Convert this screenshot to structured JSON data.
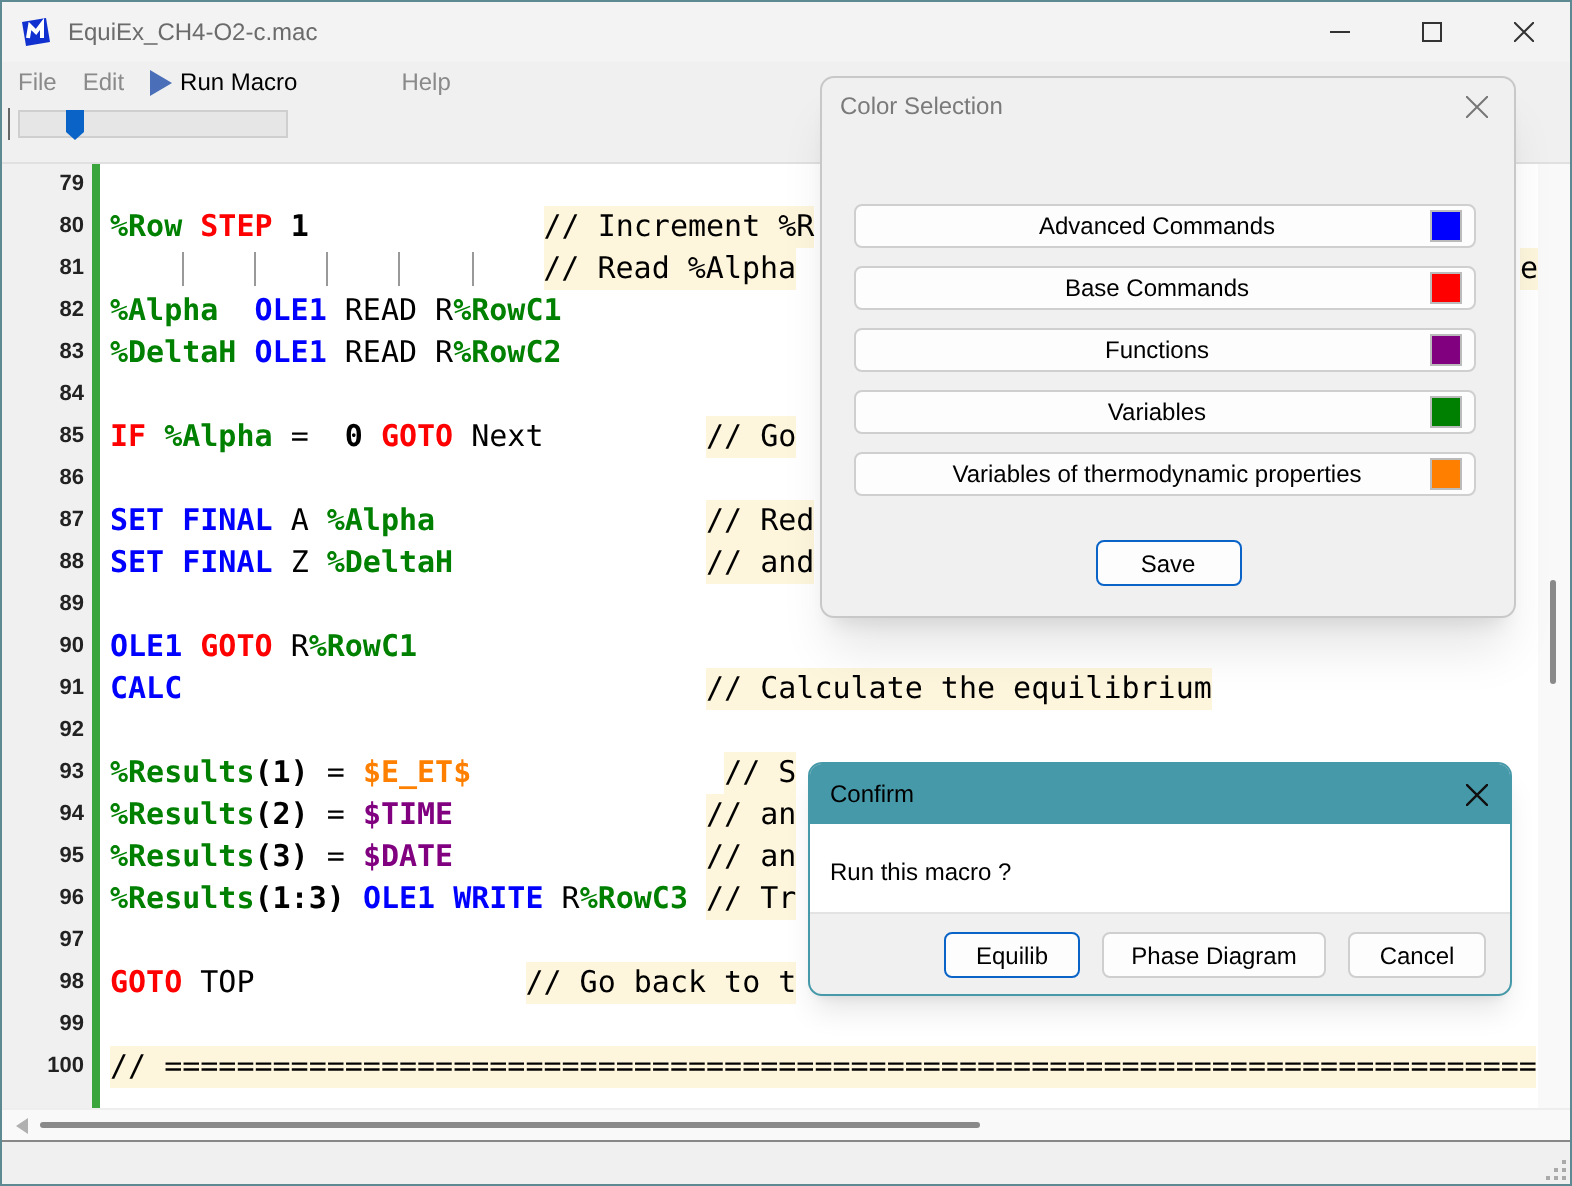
{
  "window": {
    "title": "EquiEx_CH4-O2-c.mac"
  },
  "menu": [
    {
      "label": "File",
      "kind": "text",
      "disabled": true
    },
    {
      "label": "Edit",
      "kind": "text",
      "disabled": true
    },
    {
      "label": "Run Macro",
      "kind": "run",
      "disabled": false
    },
    {
      "label": "Help",
      "kind": "text",
      "disabled": true
    }
  ],
  "speed_slider": {
    "level": 0.2
  },
  "editor": {
    "lines": [
      {
        "number": "79"
      },
      {
        "number": "80",
        "tokens": [
          {
            "kind": "var",
            "text": "%Row"
          },
          {
            "kind": "base",
            "text": " STEP"
          },
          {
            "kind": "num",
            "text": " 1"
          },
          {
            "kind": "comment",
            "text": "             // Increment %R"
          }
        ]
      },
      {
        "number": "81",
        "tokens": [
          {
            "kind": "tab"
          },
          {
            "kind": "tab"
          },
          {
            "kind": "tab"
          },
          {
            "kind": "tab"
          },
          {
            "kind": "tab"
          },
          {
            "kind": "tab"
          },
          {
            "kind": "comment",
            "text": "// Read %Alpha"
          },
          {
            "kind": "comment_tail",
            "text": "e"
          }
        ]
      },
      {
        "number": "82",
        "tokens": [
          {
            "kind": "var",
            "text": "%Alpha"
          },
          {
            "kind": "adv",
            "text": "  OLE1"
          },
          {
            "kind": "plain",
            "text": " READ R"
          },
          {
            "kind": "var",
            "text": "%RowC1"
          }
        ]
      },
      {
        "number": "83",
        "tokens": [
          {
            "kind": "var",
            "text": "%DeltaH"
          },
          {
            "kind": "adv",
            "text": " OLE1"
          },
          {
            "kind": "plain",
            "text": " READ R"
          },
          {
            "kind": "var",
            "text": "%RowC2"
          }
        ]
      },
      {
        "number": "84"
      },
      {
        "number": "85",
        "tokens": [
          {
            "kind": "base",
            "text": "IF"
          },
          {
            "kind": "var",
            "text": " %Alpha"
          },
          {
            "kind": "plain",
            "text": " =  "
          },
          {
            "kind": "num",
            "text": "0"
          },
          {
            "kind": "base",
            "text": " GOTO"
          },
          {
            "kind": "plain",
            "text": " Next"
          },
          {
            "kind": "comment",
            "text": "         // Go"
          }
        ]
      },
      {
        "number": "86"
      },
      {
        "number": "87",
        "tokens": [
          {
            "kind": "adv",
            "text": "SET"
          },
          {
            "kind": "adv",
            "text": " FINAL"
          },
          {
            "kind": "plain",
            "text": " A "
          },
          {
            "kind": "var",
            "text": "%Alpha"
          },
          {
            "kind": "comment",
            "text": "               // Red"
          }
        ]
      },
      {
        "number": "88",
        "tokens": [
          {
            "kind": "adv",
            "text": "SET"
          },
          {
            "kind": "adv",
            "text": " FINAL"
          },
          {
            "kind": "plain",
            "text": " Z "
          },
          {
            "kind": "var",
            "text": "%DeltaH"
          },
          {
            "kind": "comment",
            "text": "              // and"
          }
        ]
      },
      {
        "number": "89"
      },
      {
        "number": "90",
        "tokens": [
          {
            "kind": "adv",
            "text": "OLE1"
          },
          {
            "kind": "base",
            "text": " GOTO"
          },
          {
            "kind": "plain",
            "text": " R"
          },
          {
            "kind": "var",
            "text": "%RowC1"
          }
        ]
      },
      {
        "number": "91",
        "tokens": [
          {
            "kind": "adv",
            "text": "CALC"
          },
          {
            "kind": "comment",
            "text": "                             // Calculate the equilibrium"
          }
        ]
      },
      {
        "number": "92"
      },
      {
        "number": "93",
        "tokens": [
          {
            "kind": "var",
            "text": "%Results"
          },
          {
            "kind": "num",
            "text": "(1)"
          },
          {
            "kind": "plain",
            "text": " = "
          },
          {
            "kind": "thermo",
            "text": "$E_ET$"
          },
          {
            "kind": "comment",
            "text": "              // S"
          }
        ]
      },
      {
        "number": "94",
        "tokens": [
          {
            "kind": "var",
            "text": "%Results"
          },
          {
            "kind": "num",
            "text": "(2)"
          },
          {
            "kind": "plain",
            "text": " = "
          },
          {
            "kind": "func",
            "text": "$TIME"
          },
          {
            "kind": "comment",
            "text": "              // an"
          }
        ]
      },
      {
        "number": "95",
        "tokens": [
          {
            "kind": "var",
            "text": "%Results"
          },
          {
            "kind": "num",
            "text": "(3)"
          },
          {
            "kind": "plain",
            "text": " = "
          },
          {
            "kind": "func",
            "text": "$DATE"
          },
          {
            "kind": "comment",
            "text": "              // an"
          }
        ]
      },
      {
        "number": "96",
        "tokens": [
          {
            "kind": "var",
            "text": "%Results"
          },
          {
            "kind": "num",
            "text": "(1:3)"
          },
          {
            "kind": "adv",
            "text": " OLE1"
          },
          {
            "kind": "adv",
            "text": " WRITE"
          },
          {
            "kind": "plain",
            "text": " R"
          },
          {
            "kind": "var",
            "text": "%RowC3"
          },
          {
            "kind": "comment",
            "text": " // Tr"
          }
        ]
      },
      {
        "number": "97"
      },
      {
        "number": "98",
        "tokens": [
          {
            "kind": "base",
            "text": "GOTO"
          },
          {
            "kind": "plain",
            "text": " TOP"
          },
          {
            "kind": "comment",
            "text": "               // Go back to t"
          }
        ]
      },
      {
        "number": "99"
      },
      {
        "number": "100",
        "tokens": [
          {
            "kind": "comment",
            "text": "// ============================================================================"
          }
        ]
      }
    ]
  },
  "color_dialog": {
    "title": "Color Selection",
    "items": [
      {
        "label": "Advanced Commands",
        "color": "#0000ff"
      },
      {
        "label": "Base Commands",
        "color": "#ff0000"
      },
      {
        "label": "Functions",
        "color": "#800080"
      },
      {
        "label": "Variables",
        "color": "#008000"
      },
      {
        "label": "Variables of thermodynamic properties",
        "color": "#ff8000"
      }
    ],
    "buttons": [
      {
        "label": "Save",
        "default": true
      }
    ]
  },
  "confirm_dialog": {
    "title": "Confirm",
    "message": "Run this macro ?",
    "buttons": [
      {
        "label": "Equilib",
        "default": true
      },
      {
        "label": "Phase Diagram",
        "default": false
      },
      {
        "label": "Cancel",
        "default": false
      }
    ]
  }
}
